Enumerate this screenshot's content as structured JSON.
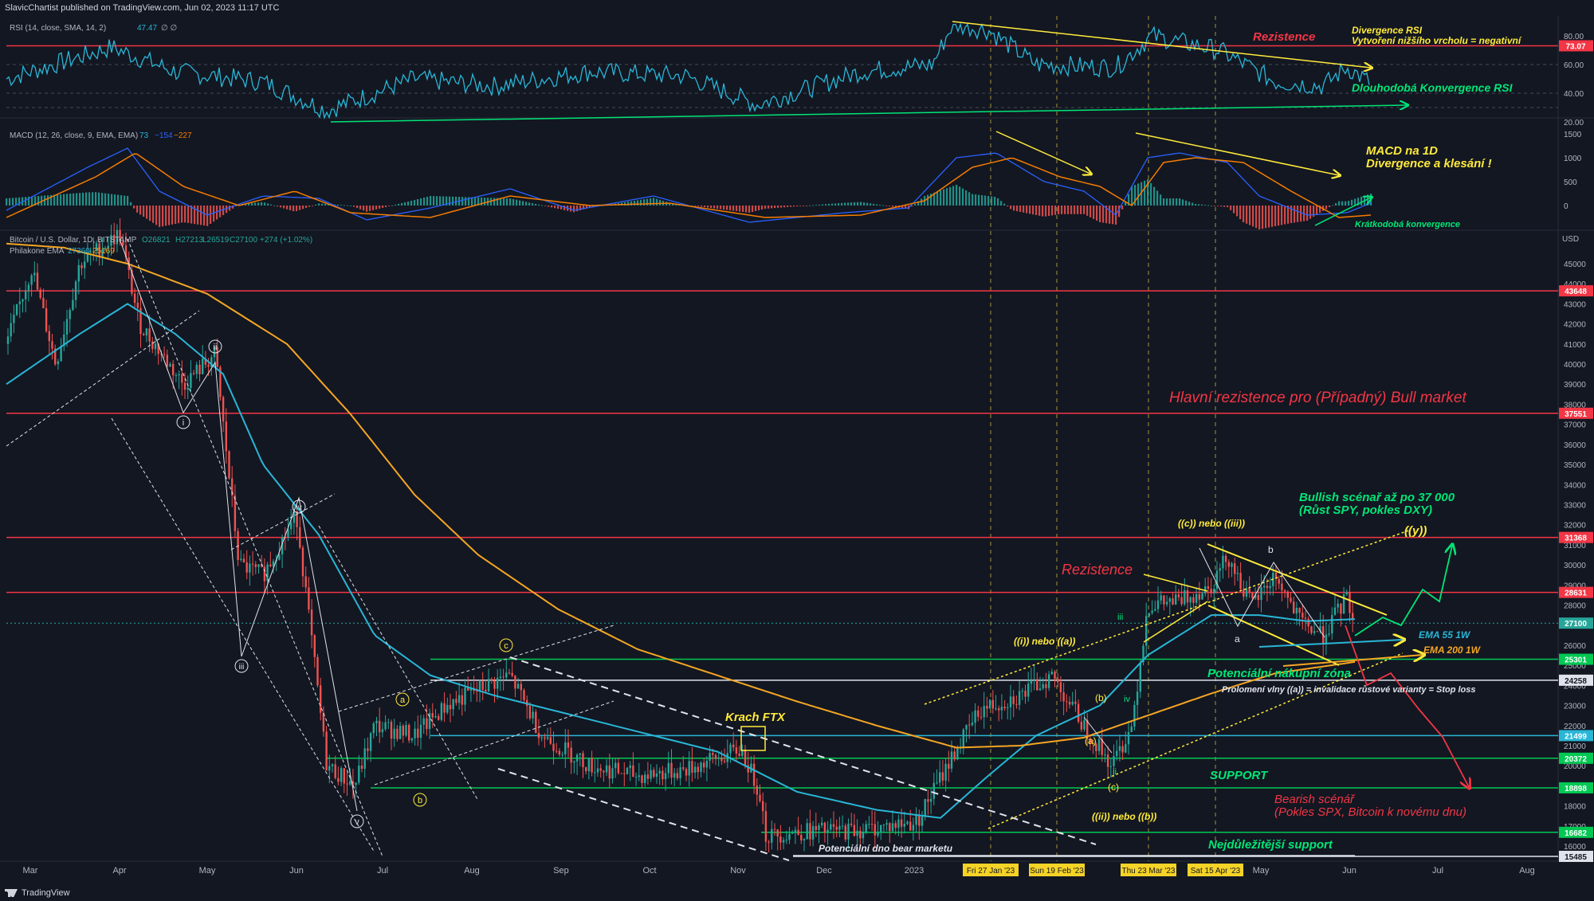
{
  "header": {
    "publisher": "SlavicChartist published on TradingView.com, Jun 02, 2023 11:17 UTC"
  },
  "footer": {
    "brand": "TradingView"
  },
  "colors": {
    "bg": "#131722",
    "up": "#26a69a",
    "down": "#ef5350",
    "ema55": "#29b6d6",
    "ema200": "#f5a623",
    "red_line": "#f23645",
    "green_line": "#00e676",
    "yellow": "#ffeb3b",
    "white": "#e0e3eb"
  },
  "rsi": {
    "legend_name": "RSI (14, close, SMA, 14, 2)",
    "legend_value": "47.47",
    "legend_extra": "∅ ∅",
    "ticks": [
      "80.00",
      "60.00",
      "40.00",
      "20.00"
    ],
    "tick_values": [
      80,
      60,
      40,
      20
    ],
    "level_label": "73.07",
    "level_value": 73.07,
    "ann_resistance": "Rezistence",
    "ann_div_title": "Divergence RSI",
    "ann_div_sub": "Vytvoření nižšího vrcholu = negativní",
    "ann_conv": "Dlouhodobá Konvergence RSI"
  },
  "macd": {
    "legend_name": "MACD (12, 26, close, 9, EMA, EMA)",
    "legend_v1": "73",
    "legend_v2": "−154",
    "legend_v3": "−227",
    "ticks": [
      "1500",
      "1000",
      "500",
      "0"
    ],
    "tick_values": [
      1500,
      1000,
      500,
      0
    ],
    "ann_title": "MACD na 1D",
    "ann_sub": "Divergence a klesání !",
    "ann_short": "Krátkodobá konvergence"
  },
  "price": {
    "legend_symbol": "Bitcoin / U.S. Dollar, 1D, BITSTAMP",
    "legend_o": "O26821",
    "legend_h": "H27213",
    "legend_l": "L26519",
    "legend_c": "C27100",
    "legend_chg": "+274 (+1.02%)",
    "legend_ema_name": "Philakone EMA",
    "legend_ema1": "27360",
    "legend_ema2": "25169",
    "currency": "USD",
    "ticks": [
      "45000",
      "44000",
      "43000",
      "42000",
      "41000",
      "40000",
      "39000",
      "38000",
      "37000",
      "36000",
      "35000",
      "34000",
      "33000",
      "32000",
      "31000",
      "30000",
      "29000",
      "28000",
      "27000",
      "26000",
      "25000",
      "24000",
      "23000",
      "22000",
      "21000",
      "20000",
      "19000",
      "18000",
      "17000",
      "16000"
    ],
    "tick_values": [
      45000,
      44000,
      43000,
      42000,
      41000,
      40000,
      39000,
      38000,
      37000,
      36000,
      35000,
      34000,
      33000,
      32000,
      31000,
      30000,
      29000,
      28000,
      27000,
      26000,
      25000,
      24000,
      23000,
      22000,
      21000,
      20000,
      19000,
      18000,
      17000,
      16000
    ],
    "levels": [
      {
        "label": "43648",
        "value": 43648,
        "color": "#f23645"
      },
      {
        "label": "37551",
        "value": 37551,
        "color": "#f23645"
      },
      {
        "label": "31368",
        "value": 31368,
        "color": "#f23645"
      },
      {
        "label": "28631",
        "value": 28631,
        "color": "#f23645"
      },
      {
        "label": "27100",
        "value": 27100,
        "color": "#26a69a"
      },
      {
        "label": "25301",
        "value": 25301,
        "color": "#00c853"
      },
      {
        "label": "24258",
        "value": 24258,
        "color": "#e0e3eb"
      },
      {
        "label": "21499",
        "value": 21499,
        "color": "#29b6d6"
      },
      {
        "label": "20372",
        "value": 20372,
        "color": "#00c853"
      },
      {
        "label": "18898",
        "value": 18898,
        "color": "#00c853"
      },
      {
        "label": "16682",
        "value": 16682,
        "color": "#00c853"
      },
      {
        "label": "15485",
        "value": 15485,
        "color": "#e0e3eb"
      }
    ]
  },
  "annotations": {
    "main_resistance": "Hlavní rezistence pro (Případný) Bull market",
    "bullish_1": "Bullish scénař až po 37 000",
    "bullish_2": "(Růst SPY, pokles DXY)",
    "rezistence": "Rezistence",
    "cc_iii": "((c)) nebo ((iii))",
    "i_a": "((i)) nebo ((a))",
    "ii_b": "((ii)) nebo ((b))",
    "y": "((y))",
    "ema55": "EMA 55 1W",
    "ema200": "EMA 200 1W",
    "buy_zone": "Potenciální nákupní zóna",
    "invalidation": "Prolomení vlny ((a)) = invalidace růstové varianty = Stop loss",
    "ftx": "Krach FTX",
    "support": "SUPPORT",
    "bearish_1": "Bearish scénář",
    "bearish_2": "(Pokles SPX, Bitcoin k novému dnu)",
    "important_support": "Nejdůležitější support",
    "bear_bottom": "Potenciální dno bear marketu",
    "wave_i": "i",
    "wave_ii": "ii",
    "wave_iii": "iii",
    "wave_iv": "iv",
    "wave_v": "v",
    "wave_a": "a",
    "wave_b": "b",
    "wave_c": "c",
    "wave_pa": "(a)",
    "wave_pb": "(b)",
    "wave_pc": "(c)",
    "wave_small_ii": "ii",
    "wave_small_iii": "iii",
    "wave_small_iv": "iv",
    "corr_a": "a",
    "corr_b": "b"
  },
  "time_axis": {
    "labels": [
      "Mar",
      "Apr",
      "May",
      "Jun",
      "Jul",
      "Aug",
      "Sep",
      "Oct",
      "Nov",
      "Dec",
      "2023",
      "Feb",
      "Mar",
      "Apr",
      "May",
      "Jun",
      "Jul",
      "Aug"
    ],
    "markers": [
      "Fri 27 Jan '23",
      "Sun 19 Feb '23",
      "Thu 23 Mar '23",
      "Sat 15 Apr '23"
    ]
  },
  "chart_data": {
    "type": "line",
    "title": "Bitcoin / U.S. Dollar, 1D, BITSTAMP",
    "x_label": "",
    "y_label": "USD",
    "x": [
      "2022-03",
      "2022-04",
      "2022-05",
      "2022-06",
      "2022-07",
      "2022-08",
      "2022-09",
      "2022-10",
      "2022-11",
      "2022-12",
      "2023-01",
      "2023-02",
      "2023-03",
      "2023-04",
      "2023-05",
      "2023-06"
    ],
    "series": [
      {
        "values": [
          43500,
          45500,
          38000,
          30000,
          19500,
          23500,
          20000,
          19500,
          17000,
          16800,
          21500,
          23500,
          27500,
          29500,
          27500,
          27100
        ]
      },
      {
        "name": "Philakone EMA",
        "values": [
          42000,
          43500,
          41000,
          33000,
          25000,
          23500,
          22000,
          20500,
          19500,
          17500,
          17500,
          21000,
          23000,
          26000,
          27200,
          27360
        ]
      },
      {
        "name": "Philakone EMA",
        "values": [
          48000,
          46500,
          43000,
          39000,
          35000,
          31000,
          28500,
          26500,
          25000,
          23500,
          21500,
          21000,
          22000,
          23500,
          24800,
          25169
        ]
      }
    ],
    "y_range": [
      15485,
      45500
    ],
    "scale": "linear",
    "grid": false
  }
}
